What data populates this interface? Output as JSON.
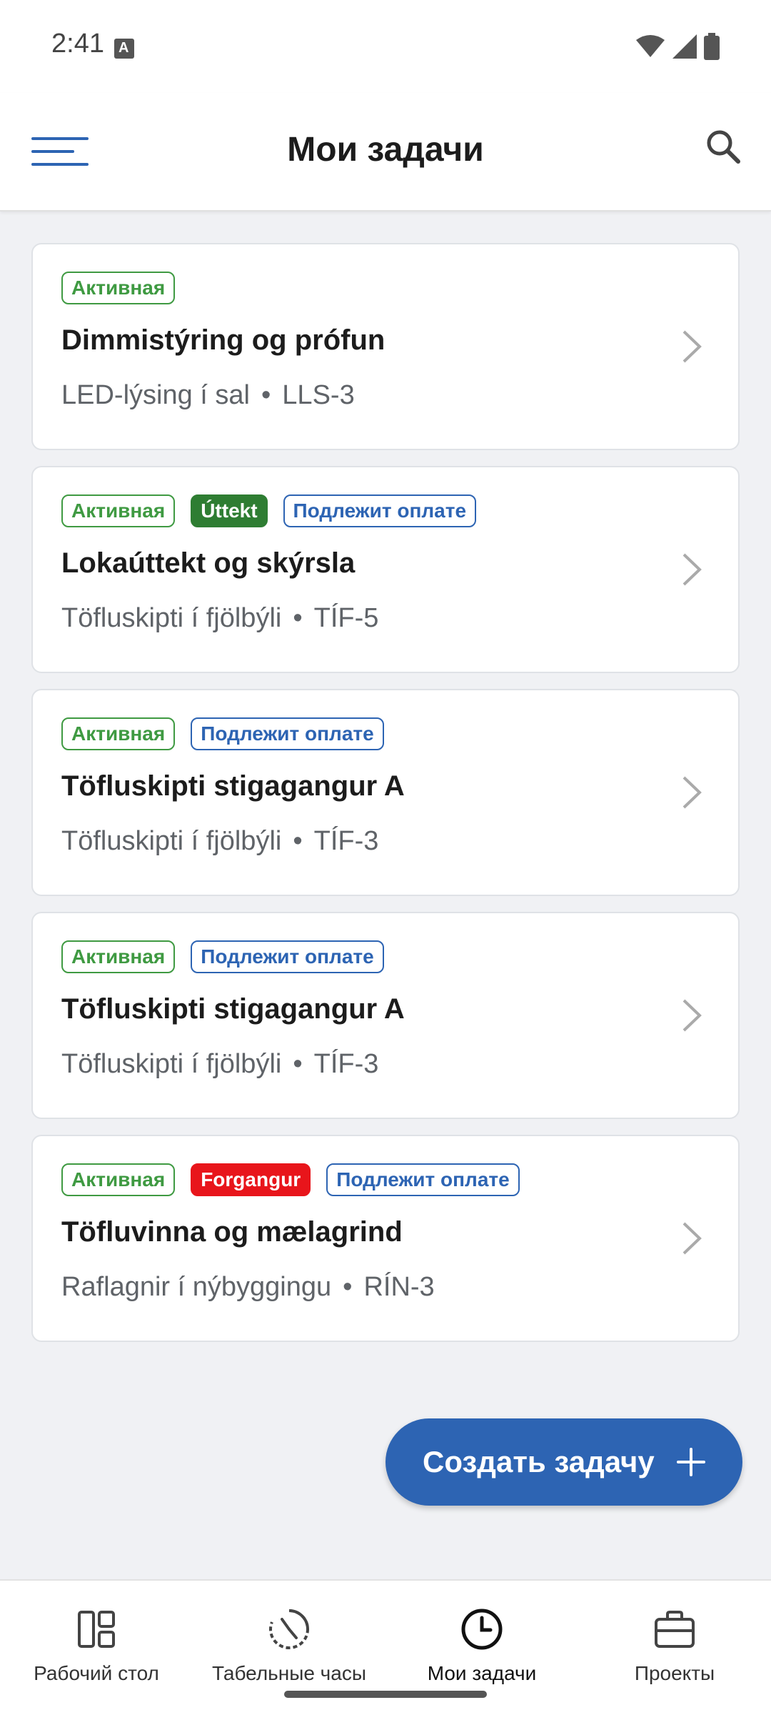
{
  "status_bar": {
    "time": "2:41",
    "notification_icon_letter": "A"
  },
  "header": {
    "title": "Мои задачи"
  },
  "badge_labels": {
    "active": "Активная",
    "billable": "Подлежит оплате",
    "uttekt": "Úttekt",
    "priority": "Forgangur"
  },
  "tasks": [
    {
      "title": "Dimmistýring og prófun",
      "project": "LED-lýsing í sal",
      "code": "LLS-3"
    },
    {
      "title": "Lokaúttekt og skýrsla",
      "project": "Töfluskipti í fjölbýli",
      "code": "TÍF-5"
    },
    {
      "title": "Töfluskipti stigagangur A",
      "project": "Töfluskipti í fjölbýli",
      "code": "TÍF-3"
    },
    {
      "title": "Töfluskipti stigagangur A",
      "project": "Töfluskipti í fjölbýli",
      "code": "TÍF-3"
    },
    {
      "title": "Töfluvinna og mælagrind",
      "project": "Raflagnir í nýbyggingu",
      "code": "RÍN-3"
    }
  ],
  "separator": "•",
  "fab": {
    "label": "Создать задачу"
  },
  "bottom_nav": {
    "items": [
      {
        "label": "Рабочий стол",
        "icon": "dashboard-icon"
      },
      {
        "label": "Табельные часы",
        "icon": "timer-icon"
      },
      {
        "label": "Мои задачи",
        "icon": "clock-icon",
        "active": true
      },
      {
        "label": "Проекты",
        "icon": "briefcase-icon"
      }
    ]
  },
  "colors": {
    "accent": "#2d64b3",
    "active_green": "#3f9a42",
    "uttekt_green": "#2e7d32",
    "priority_red": "#e8151b"
  }
}
